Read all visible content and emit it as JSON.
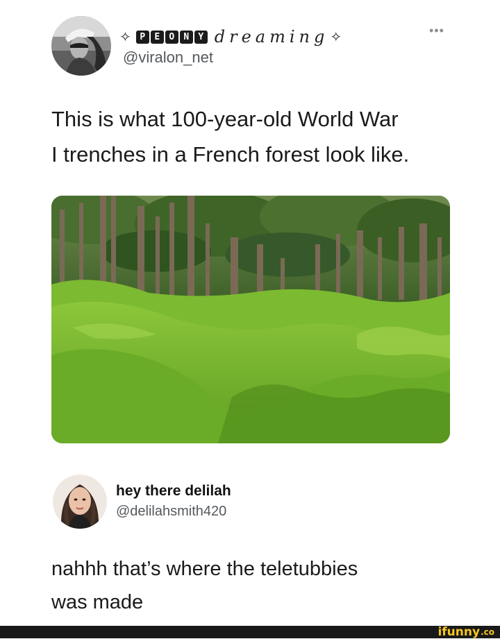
{
  "tweet": {
    "display_name": {
      "prefix_glyph": "✧",
      "boxed_letters": [
        "P",
        "E",
        "O",
        "N",
        "Y"
      ],
      "script_text": "dreaming",
      "suffix_glyph": "✧"
    },
    "handle": "@viralon_net",
    "more_icon": "•••",
    "text_lines": [
      "This is what 100-year-old World War",
      "I trenches in a French forest look like."
    ]
  },
  "reply": {
    "display_name": "hey there delilah",
    "handle": "@delilahsmith420",
    "text_lines": [
      "nahhh that’s where the teletubbies",
      "was made"
    ]
  },
  "watermark": {
    "text": "ifunny",
    "suffix": ".co"
  },
  "colors": {
    "background": "#ffffff",
    "text": "#141414",
    "handle": "#54585c",
    "footer": "#191919",
    "watermark": "#f6c521"
  }
}
